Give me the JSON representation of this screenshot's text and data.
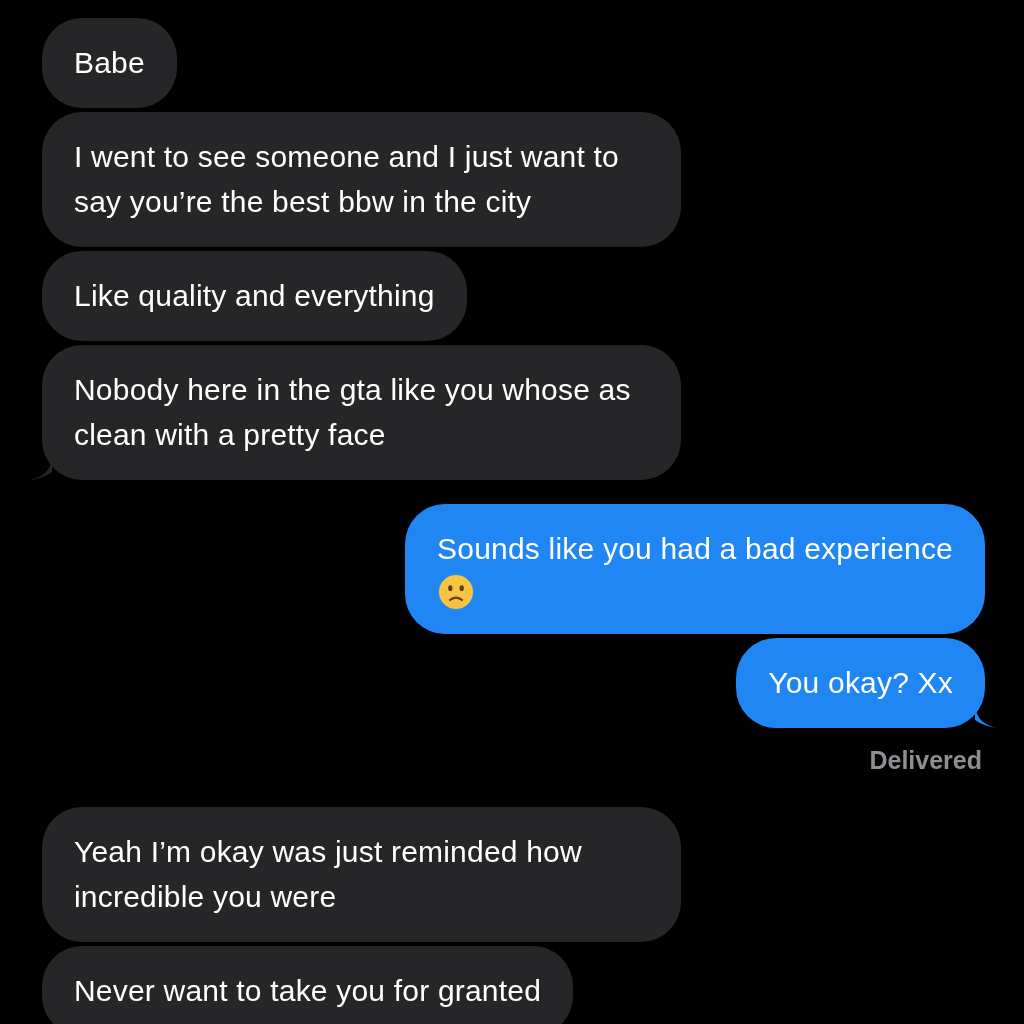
{
  "messages": [
    {
      "kind": "incoming",
      "text": "Babe",
      "tail": false
    },
    {
      "kind": "incoming",
      "text": "I went to see someone and I just want to say you’re the best bbw in the city",
      "tail": false
    },
    {
      "kind": "incoming",
      "text": "Like quality and everything",
      "tail": false
    },
    {
      "kind": "incoming",
      "text": "Nobody here in the gta like you whose as clean with a pretty face",
      "tail": true
    },
    {
      "kind": "outgoing",
      "text": "Sounds like you had a bad experience",
      "frown_emoji": true,
      "tail": false
    },
    {
      "kind": "outgoing",
      "text": "You okay? Xx",
      "tail": true,
      "status": "Delivered"
    },
    {
      "kind": "incoming",
      "text": "Yeah I’m okay was just reminded how incredible you were",
      "tail": false
    },
    {
      "kind": "incoming",
      "text": "Never want to take you for granted",
      "tail": false
    }
  ]
}
